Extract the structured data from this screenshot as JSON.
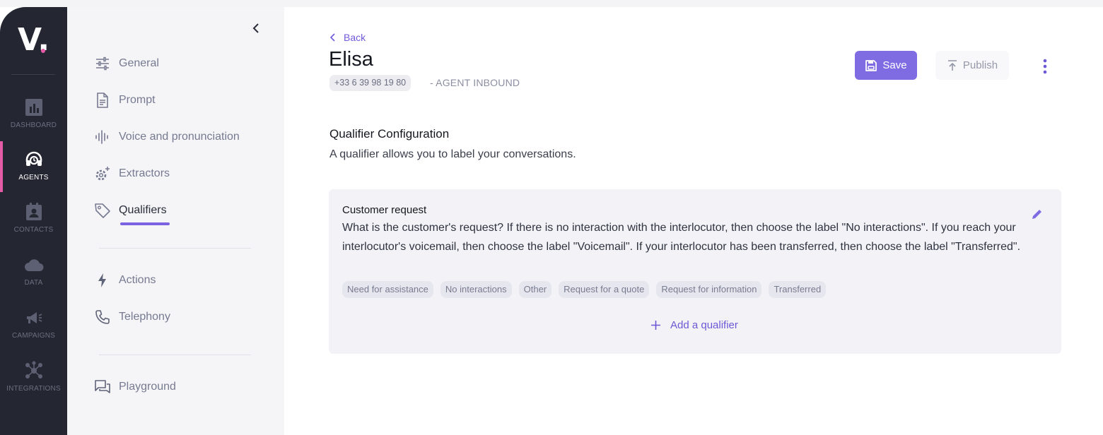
{
  "rail": {
    "logo": "V.",
    "items": [
      {
        "label": "DASHBOARD",
        "icon": "bar-chart-icon"
      },
      {
        "label": "AGENTS",
        "icon": "headset-icon",
        "active": true
      },
      {
        "label": "CONTACTS",
        "icon": "contact-card-icon"
      },
      {
        "label": "DATA",
        "icon": "cloud-icon"
      },
      {
        "label": "CAMPAIGNS",
        "icon": "megaphone-icon"
      },
      {
        "label": "INTEGRATIONS",
        "icon": "network-icon"
      }
    ]
  },
  "submenu": {
    "items": [
      {
        "label": "General",
        "icon": "sliders-icon"
      },
      {
        "label": "Prompt",
        "icon": "document-icon"
      },
      {
        "label": "Voice and pronunciation",
        "icon": "waveform-icon"
      },
      {
        "label": "Extractors",
        "icon": "gear-sparkle-icon"
      },
      {
        "label": "Qualifiers",
        "icon": "tag-icon",
        "active": true
      },
      {
        "label": "Actions",
        "icon": "lightning-icon"
      },
      {
        "label": "Telephony",
        "icon": "phone-icon"
      },
      {
        "label": "Playground",
        "icon": "chat-icon"
      }
    ]
  },
  "header": {
    "back_label": "Back",
    "agent_name": "Elisa",
    "phone": "+33 6 39 98 19 80",
    "agent_type": "- AGENT INBOUND",
    "save_label": "Save",
    "publish_label": "Publish"
  },
  "section": {
    "title": "Qualifier Configuration",
    "description": "A qualifier allows you to label your conversations."
  },
  "qualifier": {
    "name": "Customer request",
    "description": "What is the customer's request? If there is no interaction with the interlocutor, then choose the label \"No interactions\". If you reach your interlocutor's voicemail, then choose the label \"Voicemail\". If your interlocutor has been transferred, then choose the label \"Transferred\".",
    "labels": [
      "Need for assistance",
      "No interactions",
      "Other",
      "Request for a quote",
      "Request for information",
      "Transferred"
    ]
  },
  "add_qualifier_label": "Add a qualifier",
  "colors": {
    "rail_bg": "#242631",
    "accent": "#7f6be2",
    "active_marker": "#e35ba6",
    "submenu_bg": "#f5f5f8"
  }
}
